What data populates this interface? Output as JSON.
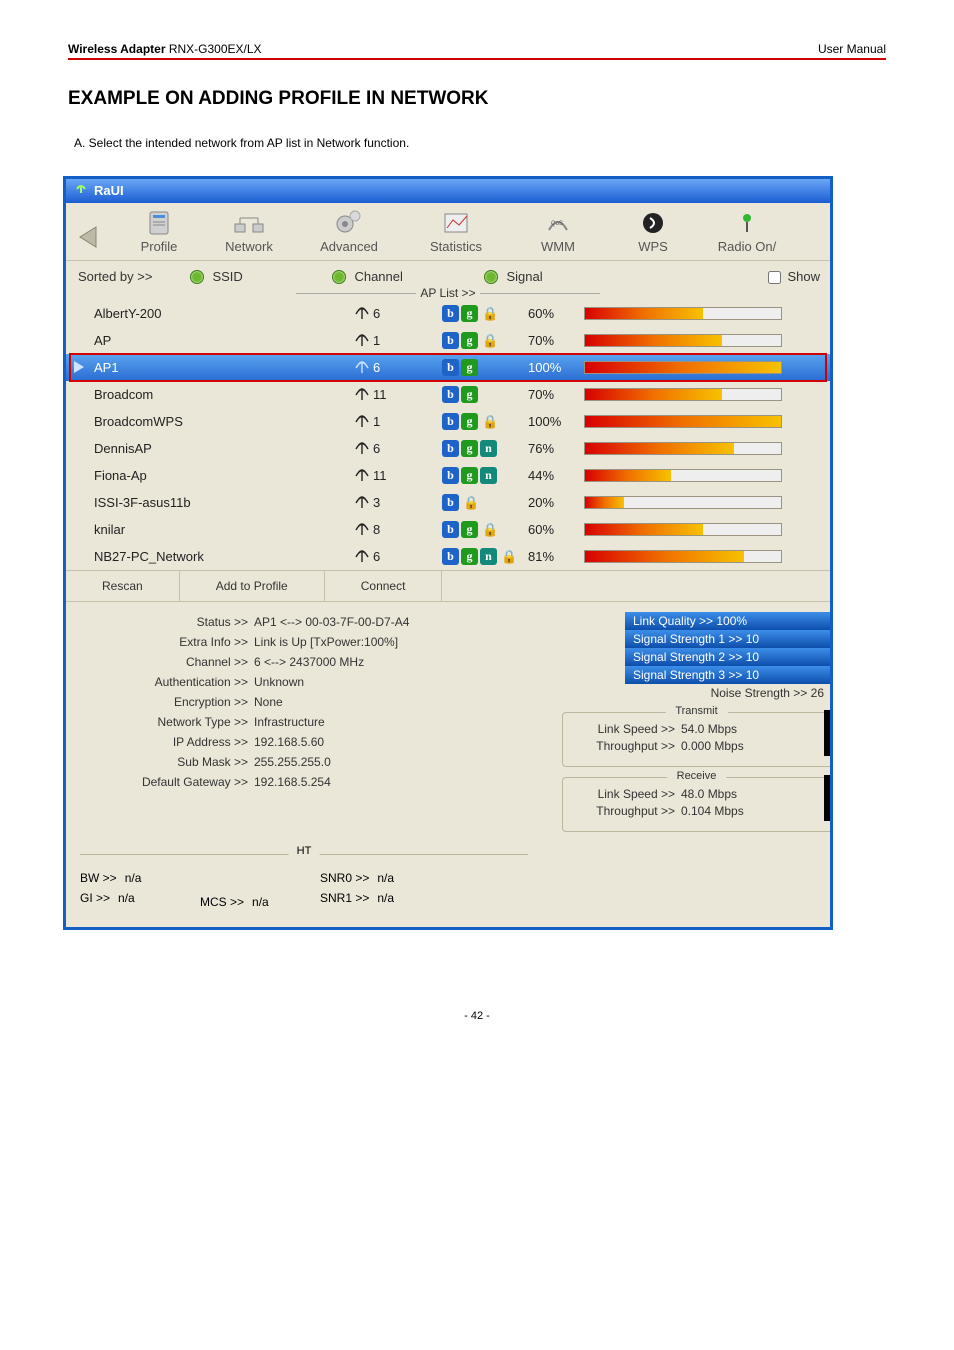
{
  "header": {
    "product_bold": "Wireless Adapter",
    "product_model": " RNX-G300EX/LX",
    "right": "User Manual"
  },
  "section_title": "EXAMPLE ON ADDING PROFILE IN NETWORK",
  "intro": "A. Select the intended network from AP list in Network function.",
  "titlebar": "RaUI",
  "toolbar": {
    "profile": "Profile",
    "network": "Network",
    "advanced": "Advanced",
    "statistics": "Statistics",
    "wmm": "WMM",
    "wps": "WPS",
    "radio": "Radio On/"
  },
  "sort": {
    "label": "Sorted by >>",
    "ssid": "SSID",
    "channel": "Channel",
    "signal": "Signal",
    "aplist": "AP List >>",
    "show": "Show"
  },
  "ap_list": [
    {
      "ssid": "AlbertY-200",
      "ch": "6",
      "modes": [
        "b",
        "g"
      ],
      "lock": true,
      "signal": "60%",
      "pct": 60,
      "sel": false
    },
    {
      "ssid": "AP",
      "ch": "1",
      "modes": [
        "b",
        "g"
      ],
      "lock": true,
      "signal": "70%",
      "pct": 70,
      "sel": false
    },
    {
      "ssid": "AP1",
      "ch": "6",
      "modes": [
        "b",
        "g"
      ],
      "lock": false,
      "signal": "100%",
      "pct": 100,
      "sel": true
    },
    {
      "ssid": "Broadcom",
      "ch": "11",
      "modes": [
        "b",
        "g"
      ],
      "lock": false,
      "signal": "70%",
      "pct": 70,
      "sel": false
    },
    {
      "ssid": "BroadcomWPS",
      "ch": "1",
      "modes": [
        "b",
        "g"
      ],
      "lock": true,
      "signal": "100%",
      "pct": 100,
      "sel": false
    },
    {
      "ssid": "DennisAP",
      "ch": "6",
      "modes": [
        "b",
        "g",
        "n"
      ],
      "lock": false,
      "signal": "76%",
      "pct": 76,
      "sel": false
    },
    {
      "ssid": "Fiona-Ap",
      "ch": "11",
      "modes": [
        "b",
        "g",
        "n"
      ],
      "lock": false,
      "signal": "44%",
      "pct": 44,
      "sel": false
    },
    {
      "ssid": "ISSI-3F-asus11b",
      "ch": "3",
      "modes": [
        "b"
      ],
      "lock": true,
      "signal": "20%",
      "pct": 20,
      "sel": false
    },
    {
      "ssid": "knilar",
      "ch": "8",
      "modes": [
        "b",
        "g"
      ],
      "lock": true,
      "signal": "60%",
      "pct": 60,
      "sel": false
    },
    {
      "ssid": "NB27-PC_Network",
      "ch": "6",
      "modes": [
        "b",
        "g",
        "n"
      ],
      "lock": true,
      "signal": "81%",
      "pct": 81,
      "sel": false
    }
  ],
  "buttons": {
    "rescan": "Rescan",
    "add": "Add to Profile",
    "connect": "Connect"
  },
  "status": {
    "rows": [
      {
        "k": "Status >>",
        "v": "AP1 <--> 00-03-7F-00-D7-A4"
      },
      {
        "k": "Extra Info >>",
        "v": "Link is Up [TxPower:100%]"
      },
      {
        "k": "Channel >>",
        "v": "6 <--> 2437000 MHz"
      },
      {
        "k": "Authentication >>",
        "v": "Unknown"
      },
      {
        "k": "Encryption >>",
        "v": "None"
      },
      {
        "k": "Network Type >>",
        "v": "Infrastructure"
      },
      {
        "k": "IP Address >>",
        "v": "192.168.5.60"
      },
      {
        "k": "Sub Mask >>",
        "v": "255.255.255.0"
      },
      {
        "k": "Default Gateway >>",
        "v": "192.168.5.254"
      }
    ],
    "badges": [
      "Link Quality >> 100%",
      "Signal Strength 1 >> 10",
      "Signal Strength 2 >> 10",
      "Signal Strength 3 >> 10"
    ],
    "noise": "Noise Strength >> 26",
    "transmit": {
      "legend": "Transmit",
      "speed_k": "Link Speed >>",
      "speed_v": "54.0 Mbps",
      "tp_k": "Throughput >>",
      "tp_v": "0.000 Mbps"
    },
    "receive": {
      "legend": "Receive",
      "speed_k": "Link Speed >>",
      "speed_v": "48.0 Mbps",
      "tp_k": "Throughput >>",
      "tp_v": "0.104 Mbps"
    }
  },
  "ht": {
    "legend": "HT",
    "bw_k": "BW >>",
    "bw_v": "n/a",
    "gi_k": "GI >>",
    "gi_v": "n/a",
    "mcs_k": "MCS >>",
    "mcs_v": "n/a",
    "snr0_k": "SNR0 >>",
    "snr0_v": "n/a",
    "snr1_k": "SNR1 >>",
    "snr1_v": "n/a"
  },
  "page_num": "- 42 -",
  "chart_data": {
    "type": "bar",
    "title": "AP Signal Strength",
    "categories": [
      "AlbertY-200",
      "AP",
      "AP1",
      "Broadcom",
      "BroadcomWPS",
      "DennisAP",
      "Fiona-Ap",
      "ISSI-3F-asus11b",
      "knilar",
      "NB27-PC_Network"
    ],
    "values": [
      60,
      70,
      100,
      70,
      100,
      76,
      44,
      20,
      60,
      81
    ],
    "ylim": [
      0,
      100
    ],
    "xlabel": "",
    "ylabel": "Signal %"
  }
}
